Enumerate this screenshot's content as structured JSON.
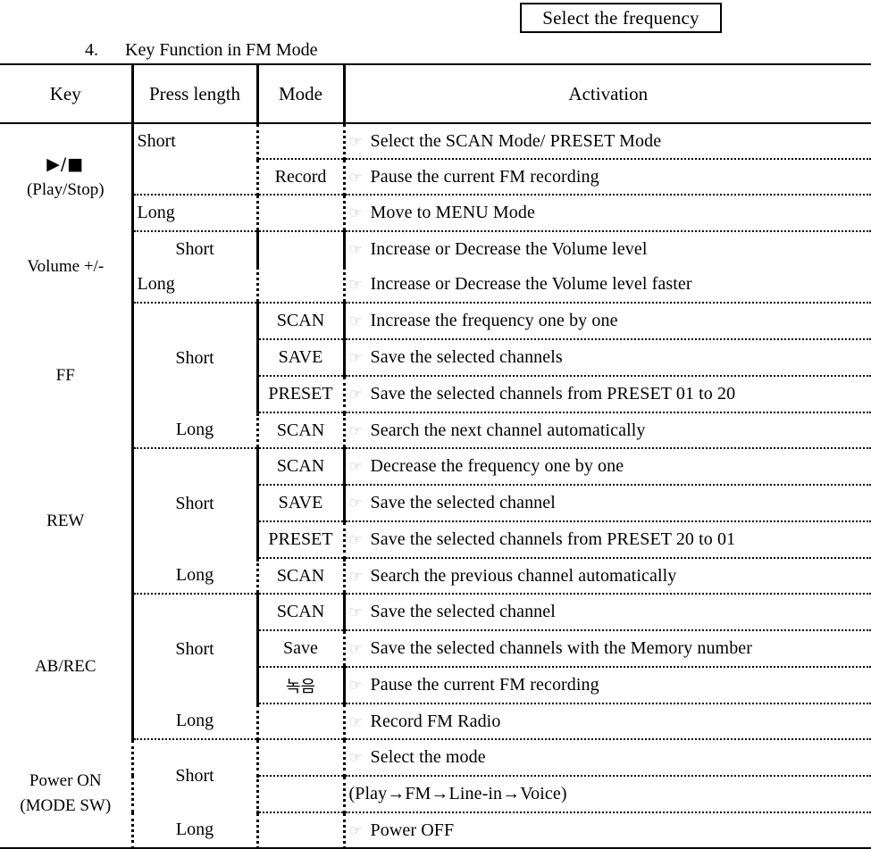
{
  "callout": {
    "label": "Select the frequency"
  },
  "heading": {
    "number": "4.",
    "title": "Key Function in FM Mode"
  },
  "table": {
    "headers": {
      "key": "Key",
      "press_length": "Press length",
      "mode": "Mode",
      "activation": "Activation"
    },
    "icon": "pointing-hand",
    "rows": [
      {
        "key_symbol": "▶/■",
        "key_label": "(Play/Stop)",
        "lines": [
          {
            "press": "Short",
            "mode": "",
            "activation": "Select the SCAN Mode/ PRESET Mode"
          },
          {
            "press": "",
            "mode": "Record",
            "activation": "Pause the current FM recording"
          },
          {
            "press": "Long",
            "mode": "",
            "activation": "Move to MENU Mode"
          }
        ]
      },
      {
        "key_symbol": "",
        "key_label": "Volume +/-",
        "lines": [
          {
            "press": "Short",
            "mode": "",
            "activation": "Increase or Decrease the Volume level"
          },
          {
            "press": "Long",
            "mode": "",
            "activation": "Increase or Decrease the Volume level faster"
          }
        ]
      },
      {
        "key_symbol": "",
        "key_label": "FF",
        "lines": [
          {
            "press": "Short",
            "mode": "SCAN",
            "activation": "Increase the frequency one by one"
          },
          {
            "press": "",
            "mode": "SAVE",
            "activation": "Save the selected channels"
          },
          {
            "press": "",
            "mode": "PRESET",
            "activation": "Save the selected channels from PRESET 01 to 20"
          },
          {
            "press": "Long",
            "mode": "SCAN",
            "activation": "Search the next channel automatically"
          }
        ]
      },
      {
        "key_symbol": "",
        "key_label": "REW",
        "lines": [
          {
            "press": "Short",
            "mode": "SCAN",
            "activation": "Decrease the frequency one by one"
          },
          {
            "press": "",
            "mode": "SAVE",
            "activation": "Save the selected channel"
          },
          {
            "press": "",
            "mode": "PRESET",
            "activation": "Save the selected channels from PRESET 20 to 01"
          },
          {
            "press": "Long",
            "mode": "SCAN",
            "activation": "Search the previous channel automatically"
          }
        ]
      },
      {
        "key_symbol": "",
        "key_label": "AB/REC",
        "lines": [
          {
            "press": "",
            "mode": "SCAN",
            "activation": "Save the selected channel"
          },
          {
            "press": "Short",
            "mode": "Save",
            "activation": "Save the selected channels with the Memory number"
          },
          {
            "press": "",
            "mode": "녹음",
            "activation": "Pause the current FM recording"
          },
          {
            "press": "Long",
            "mode": "",
            "activation": "Record FM Radio"
          }
        ]
      },
      {
        "key_symbol": "Power ON",
        "key_label": "(MODE SW)",
        "lines": [
          {
            "press": "Short",
            "mode": "",
            "activation": "Select the mode"
          },
          {
            "press": "",
            "mode": "",
            "activation": "(Play→FM→Line-in→Voice)"
          },
          {
            "press": "Long",
            "mode": "",
            "activation": "Power OFF"
          }
        ]
      }
    ]
  }
}
